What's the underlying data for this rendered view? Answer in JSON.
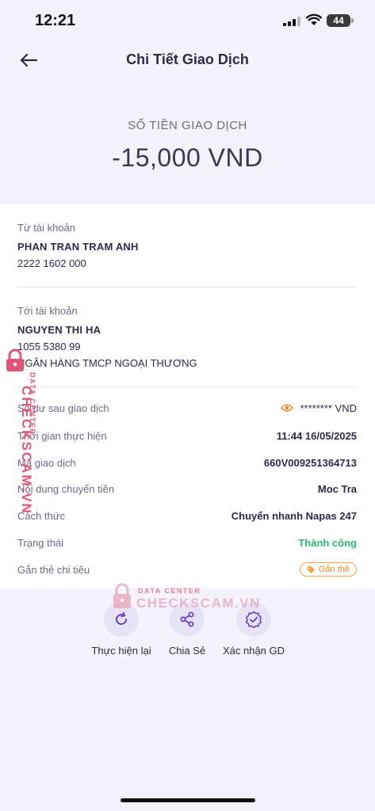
{
  "status_bar": {
    "time": "12:21",
    "battery": "44"
  },
  "header": {
    "title": "Chi Tiết Giao Dịch",
    "back_icon": "arrow-left-icon"
  },
  "amount": {
    "label": "SỐ TIỀN GIAO DỊCH",
    "value": "-15,000 VND"
  },
  "from_account": {
    "label": "Từ tài khoản",
    "name": "PHAN TRAN TRAM ANH",
    "number": "2222 1602 000"
  },
  "to_account": {
    "label": "Tới tài khoản",
    "name": "NGUYEN THI HA",
    "number": "1055 5380 99",
    "bank": "NGÂN HÀNG TMCP NGOẠI THƯƠNG"
  },
  "details": [
    {
      "label": "Số dư sau giao dịch",
      "value": "******** VND"
    },
    {
      "label": "Thời gian thực hiện",
      "value": "11:44 16/05/2025"
    },
    {
      "label": "Mã giao dịch",
      "value": "660V009251364713"
    },
    {
      "label": "Nội dung chuyển tiền",
      "value": "Moc Tra"
    },
    {
      "label": "Cách thức",
      "value": "Chuyển nhanh Napas 247"
    },
    {
      "label": "Trạng thái",
      "value": "Thành công"
    },
    {
      "label": "Gắn thẻ chi tiêu",
      "value": "Gắn thẻ"
    }
  ],
  "actions": [
    {
      "label": "Thực hiện lại",
      "icon": "refresh-icon"
    },
    {
      "label": "Chia Sẻ",
      "icon": "share-icon"
    },
    {
      "label": "Xác nhận GD",
      "icon": "verified-badge-icon"
    }
  ],
  "watermark": {
    "small": "DATA CENTER",
    "big": "CHECKSCAM.VN"
  },
  "colors": {
    "accent": "#6b3fc4",
    "success": "#2bb673",
    "tag": "#f3a53a",
    "watermark": "#e05578"
  }
}
